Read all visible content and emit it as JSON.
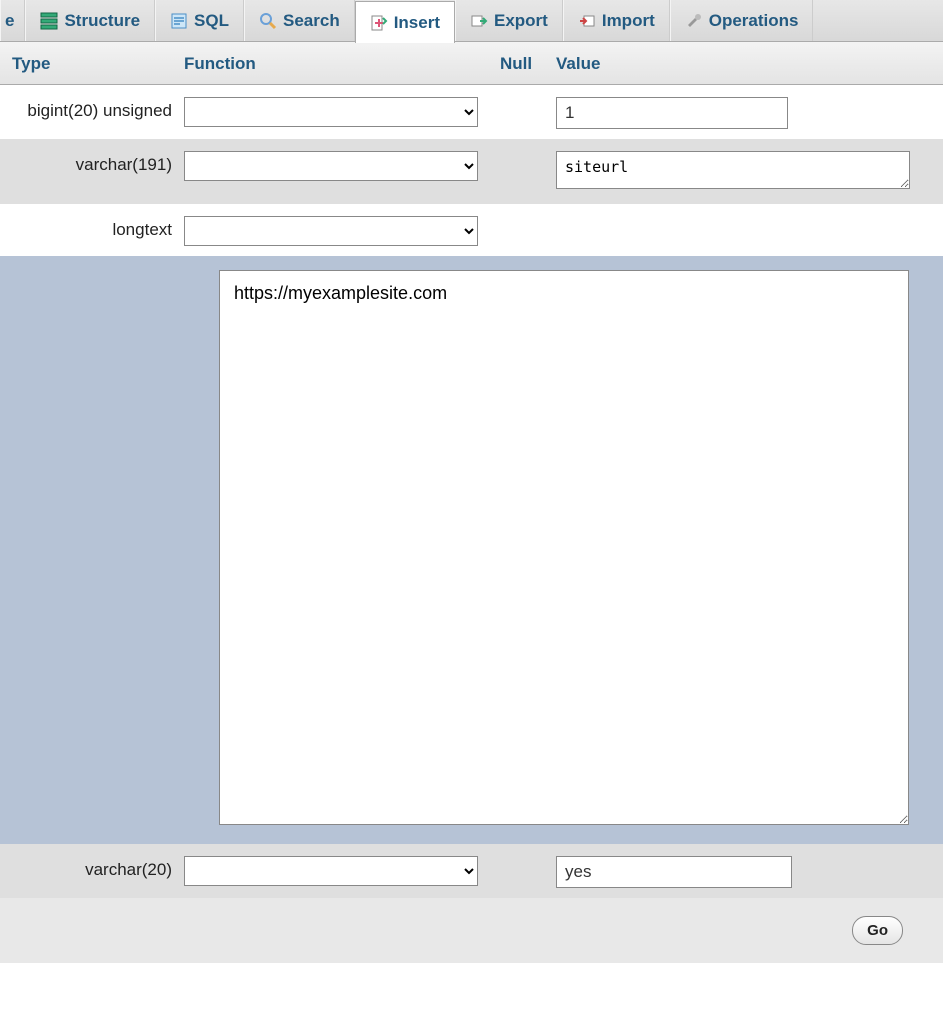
{
  "tabs": {
    "partial0": "e",
    "structure": "Structure",
    "sql": "SQL",
    "search": "Search",
    "insert": "Insert",
    "export": "Export",
    "import": "Import",
    "operations": "Operations"
  },
  "headers": {
    "type": "Type",
    "function": "Function",
    "null": "Null",
    "value": "Value"
  },
  "rows": [
    {
      "type": "bigint(20) unsigned",
      "value": "1"
    },
    {
      "type": "varchar(191)",
      "value": "siteurl"
    },
    {
      "type": "longtext",
      "value": "https://myexamplesite.com"
    },
    {
      "type": "varchar(20)",
      "value": "yes"
    }
  ],
  "go": "Go"
}
